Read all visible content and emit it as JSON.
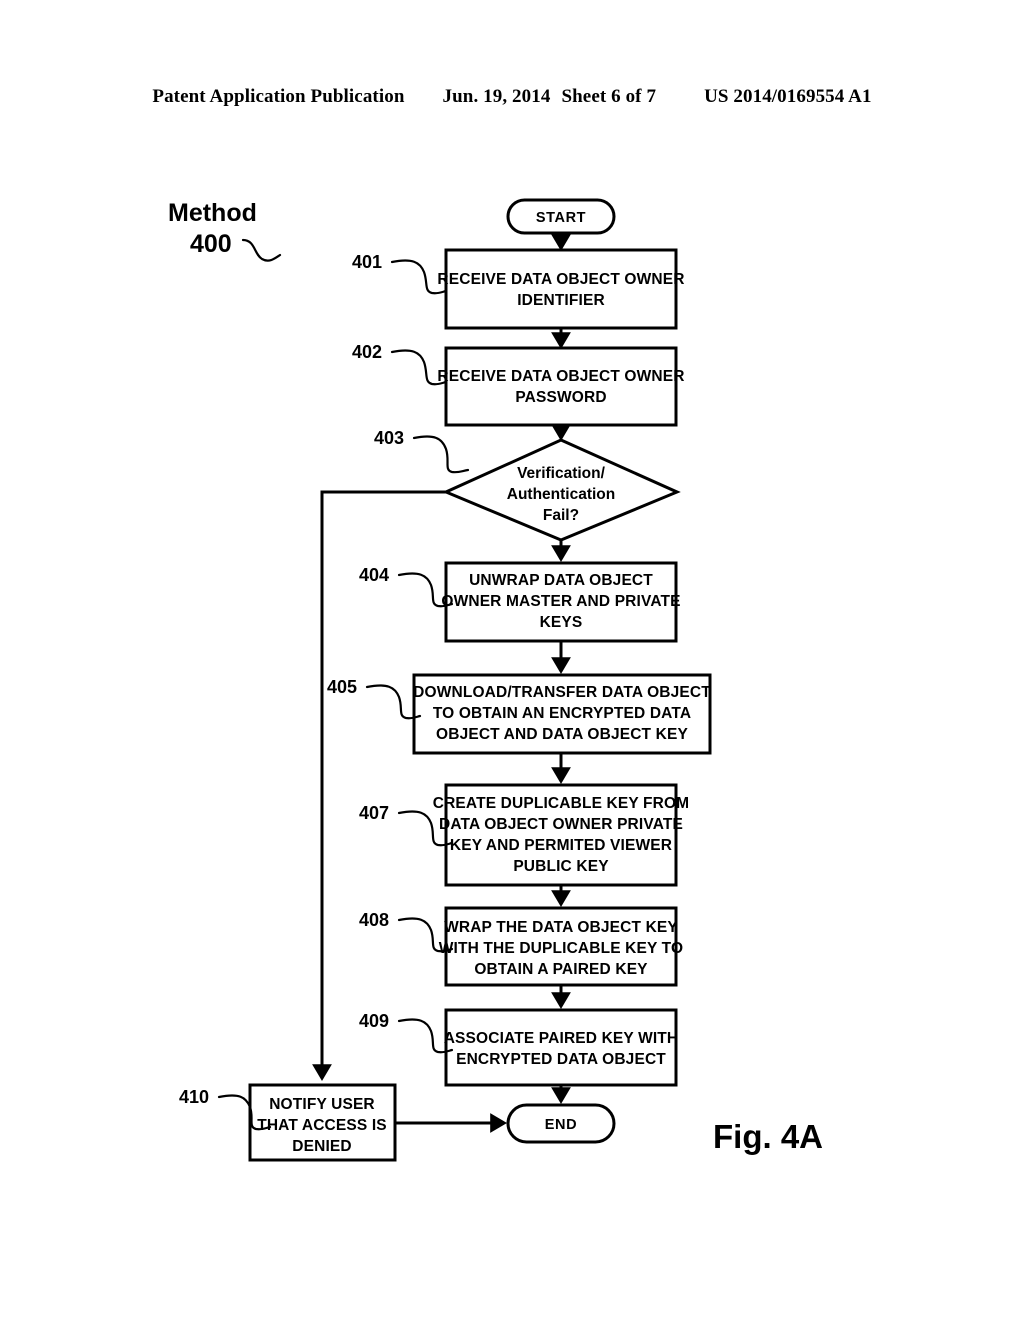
{
  "header": {
    "left": "Patent Application Publication",
    "date": "Jun. 19, 2014",
    "sheet": "Sheet 6 of 7",
    "docnum": "US 2014/0169554 A1"
  },
  "figure": {
    "method_label_line1": "Method",
    "method_label_line2": "400",
    "fig_label": "Fig. 4A",
    "start_label": "START",
    "end_label": "END"
  },
  "nodes": [
    {
      "ref": "401",
      "type": "process",
      "lines": [
        "RECEIVE DATA OBJECT OWNER",
        "IDENTIFIER"
      ]
    },
    {
      "ref": "402",
      "type": "process",
      "lines": [
        "RECEIVE DATA OBJECT OWNER",
        "PASSWORD"
      ]
    },
    {
      "ref": "403",
      "type": "decision",
      "lines": [
        "Verification/",
        "Authentication",
        "Fail?"
      ]
    },
    {
      "ref": "404",
      "type": "process",
      "lines": [
        "UNWRAP DATA OBJECT",
        "OWNER MASTER AND PRIVATE",
        "KEYS"
      ]
    },
    {
      "ref": "405",
      "type": "process",
      "lines": [
        "DOWNLOAD/TRANSFER DATA OBJECT",
        "TO OBTAIN AN ENCRYPTED DATA",
        "OBJECT AND DATA OBJECT KEY"
      ]
    },
    {
      "ref": "407",
      "type": "process",
      "lines": [
        "CREATE DUPLICABLE KEY FROM",
        "DATA OBJECT OWNER PRIVATE",
        "KEY AND PERMITED VIEWER",
        "PUBLIC KEY"
      ]
    },
    {
      "ref": "408",
      "type": "process",
      "lines": [
        "WRAP THE DATA OBJECT KEY",
        "WITH THE DUPLICABLE KEY TO",
        "OBTAIN A PAIRED KEY"
      ]
    },
    {
      "ref": "409",
      "type": "process",
      "lines": [
        "ASSOCIATE PAIRED KEY WITH",
        "ENCRYPTED DATA OBJECT"
      ]
    },
    {
      "ref": "410",
      "type": "process",
      "lines": [
        "NOTIFY USER",
        "THAT ACCESS IS",
        "DENIED"
      ]
    }
  ],
  "colors": {
    "ink": "#000000",
    "paper": "#ffffff"
  }
}
